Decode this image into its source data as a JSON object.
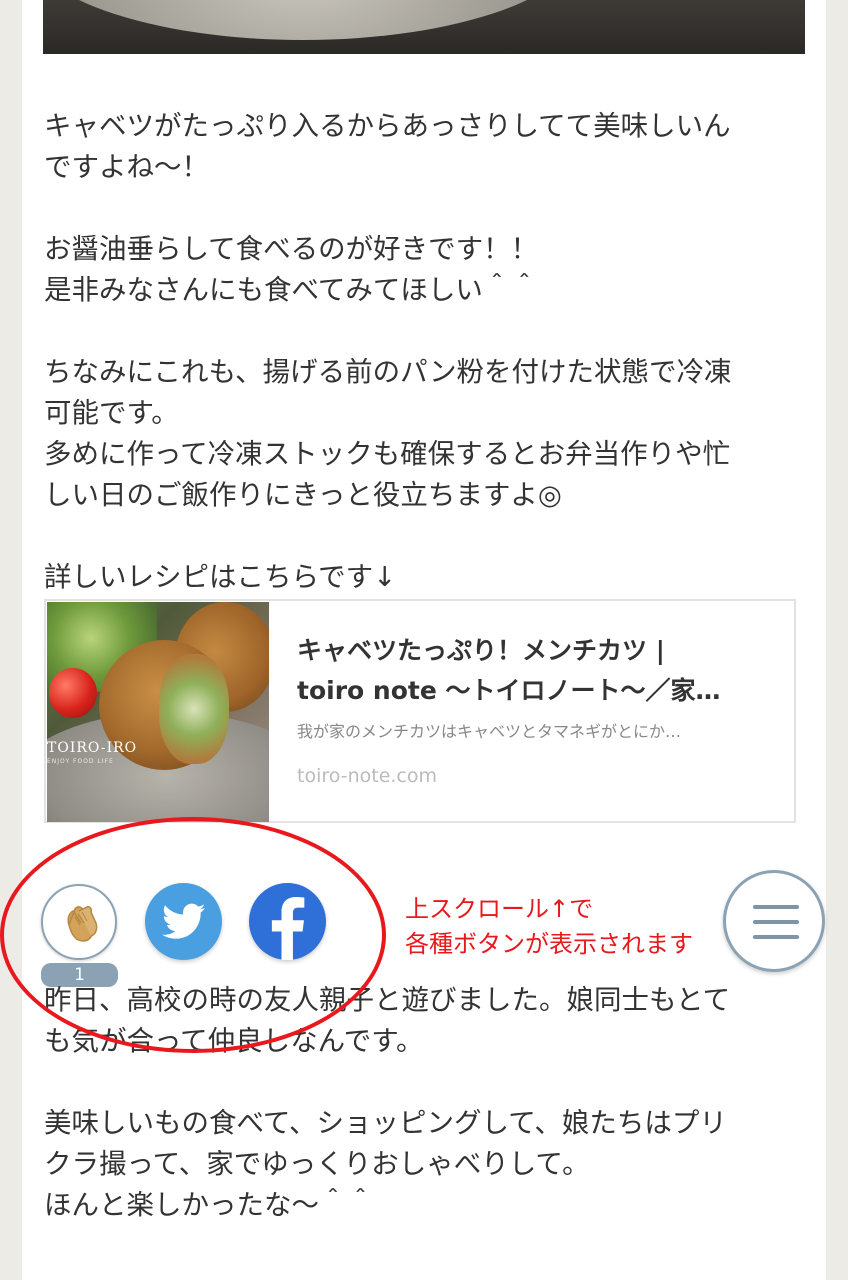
{
  "article": {
    "paragraph1": [
      "キャベツがたっぷり入るからあっさりしてて美味しいん",
      "ですよね〜！"
    ],
    "paragraph2": [
      "お醤油垂らして食べるのが好きです！！",
      "是非みなさんにも食べてみてほしい＾＾"
    ],
    "paragraph3": [
      "ちなみにこれも、揚げる前のパン粉を付けた状態で冷凍",
      "可能です。",
      "多めに作って冷凍ストックも確保するとお弁当作りや忙",
      "しい日のご飯作りにきっと役立ちますよ◎"
    ],
    "paragraph4": [
      "詳しいレシピはこちらです↓"
    ],
    "paragraph5": [
      "昨日、高校の時の友人親子と遊びました。娘同士もとて",
      "も気が合って仲良しなんです。"
    ],
    "paragraph6": [
      "美味しいもの食べて、ショッピングして、娘たちはプリ",
      "クラ撮って、家でゆっくりおしゃべりして。",
      "ほんと楽しかったな〜＾＾"
    ]
  },
  "link_card": {
    "title": [
      "キャベツたっぷり！メンチカツ |",
      "toiro note 〜トイロノート〜／家…"
    ],
    "description": "我が家のメンチカツはキャベツとタマネギがとにか…",
    "domain": "toiro-note.com",
    "thumb_logo": "TOIRO-IRO",
    "thumb_sub": "ENJOY FOOD LIFE"
  },
  "share": {
    "clap_icon": "clap-hands-icon",
    "clap_count": "1",
    "twitter_icon": "twitter-bird-icon",
    "facebook_icon": "facebook-f-icon",
    "menu_icon": "hamburger-menu-icon"
  },
  "annotation": {
    "lines": [
      "上スクロール↑で",
      "各種ボタンが表示されます"
    ],
    "color": "#e8181c"
  }
}
